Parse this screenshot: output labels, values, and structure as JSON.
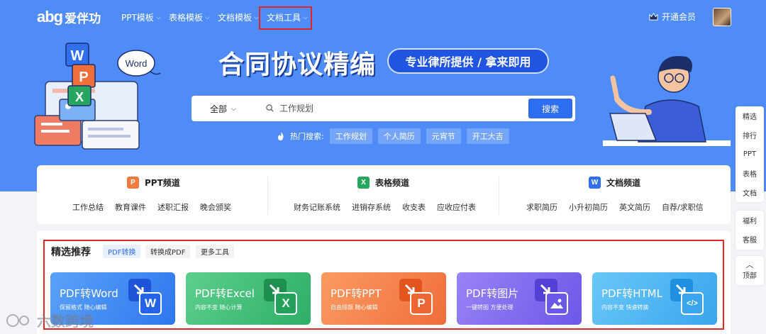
{
  "nav": {
    "logo_mark": "abg",
    "logo_name": "爱伴功",
    "items": [
      {
        "label": "PPT模板"
      },
      {
        "label": "表格模板"
      },
      {
        "label": "文档模板"
      },
      {
        "label": "文档工具"
      }
    ],
    "vip_label": "开通会员"
  },
  "hero": {
    "headline": "合同协议精编",
    "pill": "专业律所提供 / 拿来即用",
    "word_bubble": "Word",
    "search": {
      "scope": "全部",
      "placeholder": "工作规划",
      "button": "搜索"
    },
    "hot_label": "热门搜索:",
    "hot_tags": [
      "工作规划",
      "个人简历",
      "元宵节",
      "开工大吉"
    ]
  },
  "channels": [
    {
      "badge": "P",
      "color": "#f07b3f",
      "title": "PPT频道",
      "links": [
        "工作总结",
        "教育课件",
        "述职汇报",
        "晚会颁奖"
      ]
    },
    {
      "badge": "X",
      "color": "#27a660",
      "title": "表格频道",
      "links": [
        "财务记账系统",
        "进销存系统",
        "收支表",
        "应收应付表"
      ]
    },
    {
      "badge": "W",
      "color": "#2f6ff0",
      "title": "文档频道",
      "links": [
        "求职简历",
        "小升初简历",
        "英文简历",
        "自荐/求职信"
      ]
    }
  ],
  "featured": {
    "title": "精选推荐",
    "tabs": [
      {
        "label": "PDF转换",
        "active": true
      },
      {
        "label": "转换成PDF",
        "active": false
      },
      {
        "label": "更多工具",
        "active": false
      }
    ],
    "cards": [
      {
        "title": "PDF转Word",
        "subtitle": "保留格式 随心编辑",
        "glyph": "W",
        "grad_from": "#5aa2f8",
        "grad_to": "#2f76ee",
        "glyph_color": "#2f6ff0"
      },
      {
        "title": "PDF转Excel",
        "subtitle": "内容不变 随心计算",
        "glyph": "X",
        "grad_from": "#5ccf8c",
        "grad_to": "#2fae68",
        "glyph_color": "#27a660"
      },
      {
        "title": "PDF转PPT",
        "subtitle": "自由排版 随心编辑",
        "glyph": "P",
        "grad_from": "#fb9a62",
        "grad_to": "#ef6e3a",
        "glyph_color": "#ef6e3a"
      },
      {
        "title": "PDF转图片",
        "subtitle": "一键转图 方便处理",
        "glyph": "img",
        "grad_from": "#9a82f6",
        "grad_to": "#6c58e8",
        "glyph_color": "#6c58e8"
      },
      {
        "title": "PDF转HTML",
        "subtitle": "内容不变 快速转换",
        "glyph": "</>",
        "grad_from": "#68c7f7",
        "grad_to": "#3aa5ee",
        "glyph_color": "#2f95e6"
      }
    ]
  },
  "sidebar": {
    "group1": [
      "精选",
      "排行",
      "PPT",
      "表格",
      "文档"
    ],
    "group2": [
      "福利",
      "客服"
    ],
    "top_label": "顶部"
  },
  "watermark": "六数跨境"
}
